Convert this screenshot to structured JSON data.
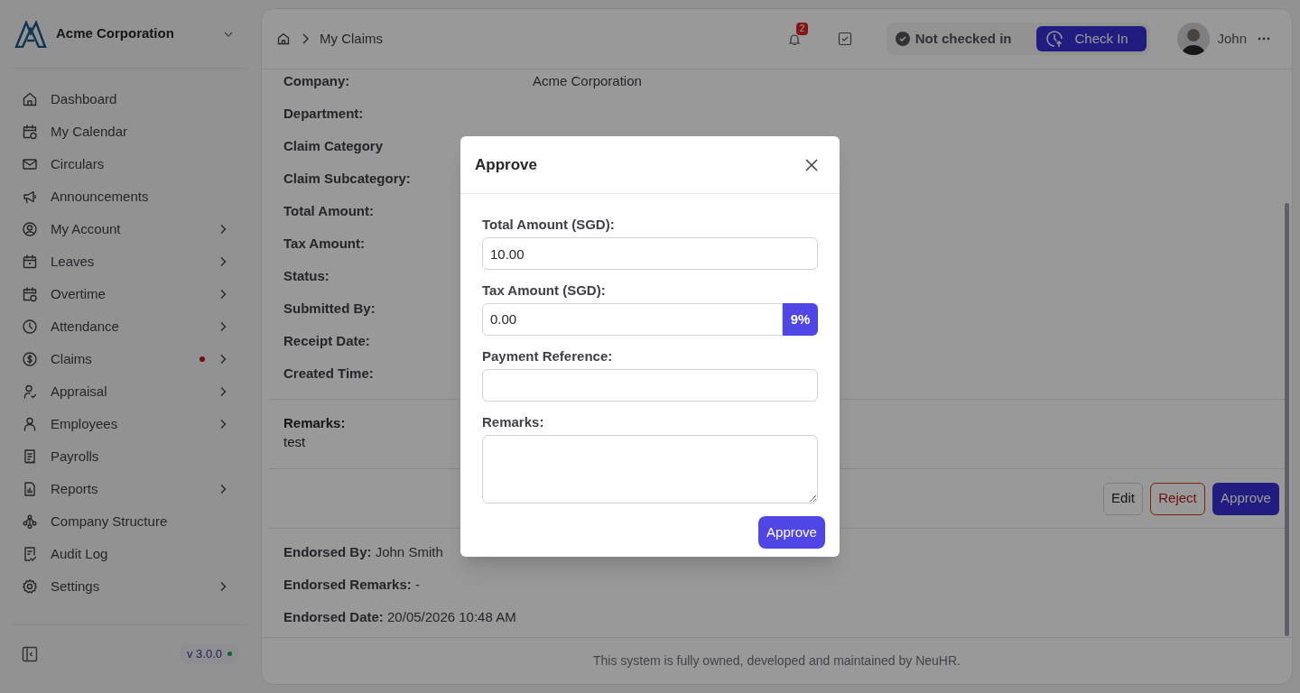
{
  "sidebar": {
    "company": "Acme Corporation",
    "items": [
      {
        "label": "Dashboard",
        "expandable": false,
        "alert": false
      },
      {
        "label": "My Calendar",
        "expandable": false,
        "alert": false
      },
      {
        "label": "Circulars",
        "expandable": false,
        "alert": false
      },
      {
        "label": "Announcements",
        "expandable": false,
        "alert": false
      },
      {
        "label": "My Account",
        "expandable": true,
        "alert": false
      },
      {
        "label": "Leaves",
        "expandable": true,
        "alert": false
      },
      {
        "label": "Overtime",
        "expandable": true,
        "alert": false
      },
      {
        "label": "Attendance",
        "expandable": true,
        "alert": false
      },
      {
        "label": "Claims",
        "expandable": true,
        "alert": true
      },
      {
        "label": "Appraisal",
        "expandable": true,
        "alert": false
      },
      {
        "label": "Employees",
        "expandable": true,
        "alert": false
      },
      {
        "label": "Payrolls",
        "expandable": false,
        "alert": false
      },
      {
        "label": "Reports",
        "expandable": true,
        "alert": false
      },
      {
        "label": "Company Structure",
        "expandable": false,
        "alert": false
      },
      {
        "label": "Audit Log",
        "expandable": false,
        "alert": false
      },
      {
        "label": "Settings",
        "expandable": true,
        "alert": false
      }
    ],
    "version": "v 3.0.0"
  },
  "header": {
    "breadcrumb": "My Claims",
    "notifications": "2",
    "checkin_status": "Not checked in",
    "checkin_button": "Check In",
    "user": "John"
  },
  "details": {
    "fields": [
      {
        "label": "Company:",
        "value": "Acme Corporation"
      },
      {
        "label": "Department:"
      },
      {
        "label": "Claim Category"
      },
      {
        "label": "Claim Subcategory:"
      },
      {
        "label": "Total Amount:"
      },
      {
        "label": "Tax Amount:"
      },
      {
        "label": "Status:"
      },
      {
        "label": "Submitted By:"
      },
      {
        "label": "Receipt Date:"
      },
      {
        "label": "Created Time:"
      }
    ],
    "remarks_label": "Remarks:",
    "remarks": "test",
    "actions": [
      {
        "label": "Edit",
        "kind": "neutral"
      },
      {
        "label": "Reject",
        "kind": "danger"
      },
      {
        "label": "Approve",
        "kind": "primary"
      }
    ],
    "endorsements": [
      "**Endorsed By:** John Smith",
      "**Endorsed Remarks:** -",
      "**Endorsed Date:** 20/05/2026 10:48 AM"
    ]
  },
  "footer": "This system is fully owned, developed and maintained by NeuHR.",
  "modal": {
    "title": "Approve",
    "fields": [
      {
        "label": "Total Amount (SGD):",
        "kind": "input",
        "value": "10.00"
      },
      {
        "label": "Tax Amount (SGD):",
        "kind": "addon",
        "value": "0.00",
        "addon": "9%"
      },
      {
        "label": "Payment Reference:",
        "kind": "input"
      },
      {
        "label": "Remarks:",
        "kind": "textarea"
      }
    ],
    "submit": "Approve"
  }
}
